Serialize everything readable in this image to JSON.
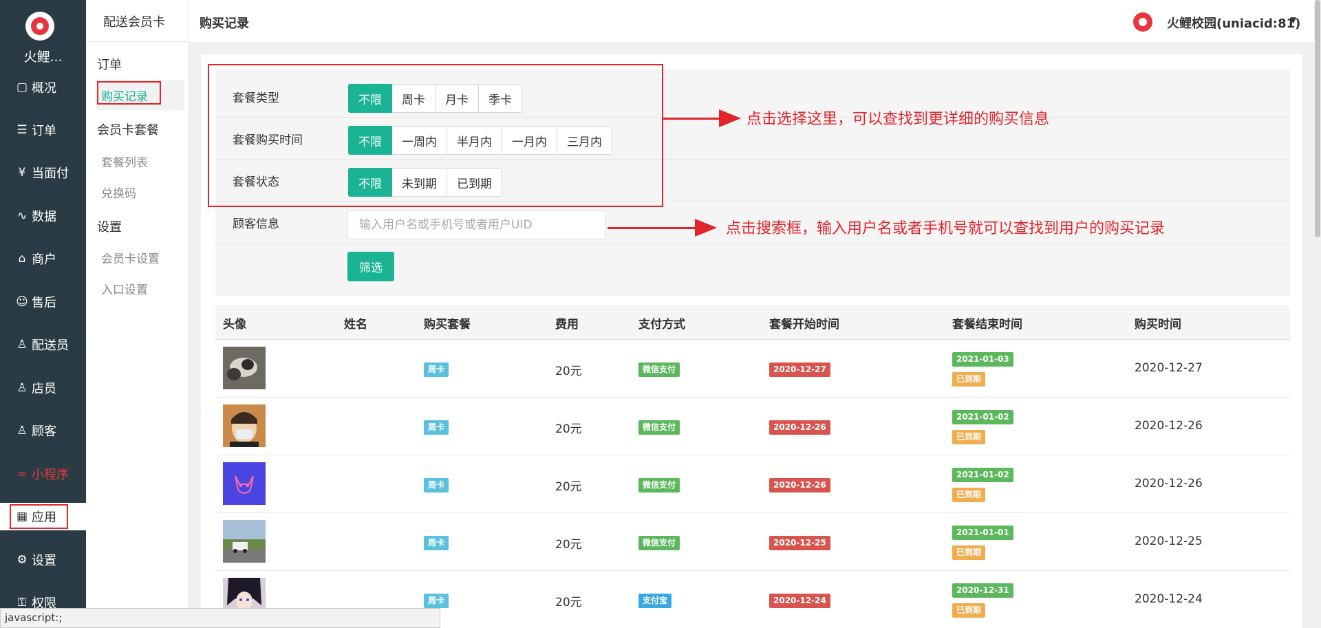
{
  "sidebar": {
    "site_name": "火鲤...",
    "items": [
      {
        "label": "概况",
        "icon": "▢"
      },
      {
        "label": "订单",
        "icon": "☰"
      },
      {
        "label": "当面付",
        "icon": "¥"
      },
      {
        "label": "数据",
        "icon": "∿"
      },
      {
        "label": "商户",
        "icon": "⌂"
      },
      {
        "label": "售后",
        "icon": "☺"
      },
      {
        "label": "配送员",
        "icon": "♙"
      },
      {
        "label": "店员",
        "icon": "♙"
      },
      {
        "label": "顾客",
        "icon": "♙"
      },
      {
        "label": "小程序",
        "icon": "∞"
      },
      {
        "label": "应用",
        "icon": "▦"
      },
      {
        "label": "设置",
        "icon": "⚙"
      },
      {
        "label": "权限",
        "icon": "⚿"
      }
    ]
  },
  "subnav": {
    "title": "配送会员卡",
    "group_order": "订单",
    "item_purchase": "购买记录",
    "group_package": "会员卡套餐",
    "item_package_list": "套餐列表",
    "item_redeem": "兑换码",
    "group_settings": "设置",
    "item_card_settings": "会员卡设置",
    "item_entry_settings": "入口设置"
  },
  "header": {
    "page_title": "购买记录",
    "user_name": "火鲤校园(uniacid:81)"
  },
  "filters": {
    "type": {
      "label": "套餐类型",
      "options": [
        "不限",
        "周卡",
        "月卡",
        "季卡"
      ]
    },
    "time": {
      "label": "套餐购买时间",
      "options": [
        "不限",
        "一周内",
        "半月内",
        "一月内",
        "三月内"
      ]
    },
    "status": {
      "label": "套餐状态",
      "options": [
        "不限",
        "未到期",
        "已到期"
      ]
    },
    "customer": {
      "label": "顾客信息",
      "placeholder": "输入用户名或手机号或者用户UID"
    },
    "submit": "筛选"
  },
  "annotations": {
    "first": "点击选择这里，可以查找到更详细的购买信息",
    "second": "点击搜索框，输入用户名或者手机号就可以查找到用户的购买记录"
  },
  "table": {
    "headers": [
      "头像",
      "姓名",
      "购买套餐",
      "费用",
      "支付方式",
      "套餐开始时间",
      "套餐结束时间",
      "购买时间"
    ],
    "rows": [
      {
        "name": "",
        "package": "周卡",
        "fee": "20元",
        "payment": "微信支付",
        "start": "2020-12-27",
        "end": "2021-01-03",
        "status": "已到期",
        "purchase": "2020-12-27"
      },
      {
        "name": "",
        "package": "周卡",
        "fee": "20元",
        "payment": "微信支付",
        "start": "2020-12-26",
        "end": "2021-01-02",
        "status": "已到期",
        "purchase": "2020-12-26"
      },
      {
        "name": "",
        "package": "周卡",
        "fee": "20元",
        "payment": "微信支付",
        "start": "2020-12-26",
        "end": "2021-01-02",
        "status": "已到期",
        "purchase": "2020-12-26"
      },
      {
        "name": "",
        "package": "周卡",
        "fee": "20元",
        "payment": "微信支付",
        "start": "2020-12-25",
        "end": "2021-01-01",
        "status": "已到期",
        "purchase": "2020-12-25"
      },
      {
        "name": "",
        "package": "周卡",
        "fee": "20元",
        "payment": "支付宝",
        "start": "2020-12-24",
        "end": "2020-12-31",
        "status": "已到期",
        "purchase": "2020-12-24"
      }
    ]
  },
  "statusbar": {
    "text": "javascript:;"
  },
  "colors": {
    "primary": "#1ab394",
    "sidebar_bg": "#2a3b45",
    "annotation": "#e2242b"
  }
}
